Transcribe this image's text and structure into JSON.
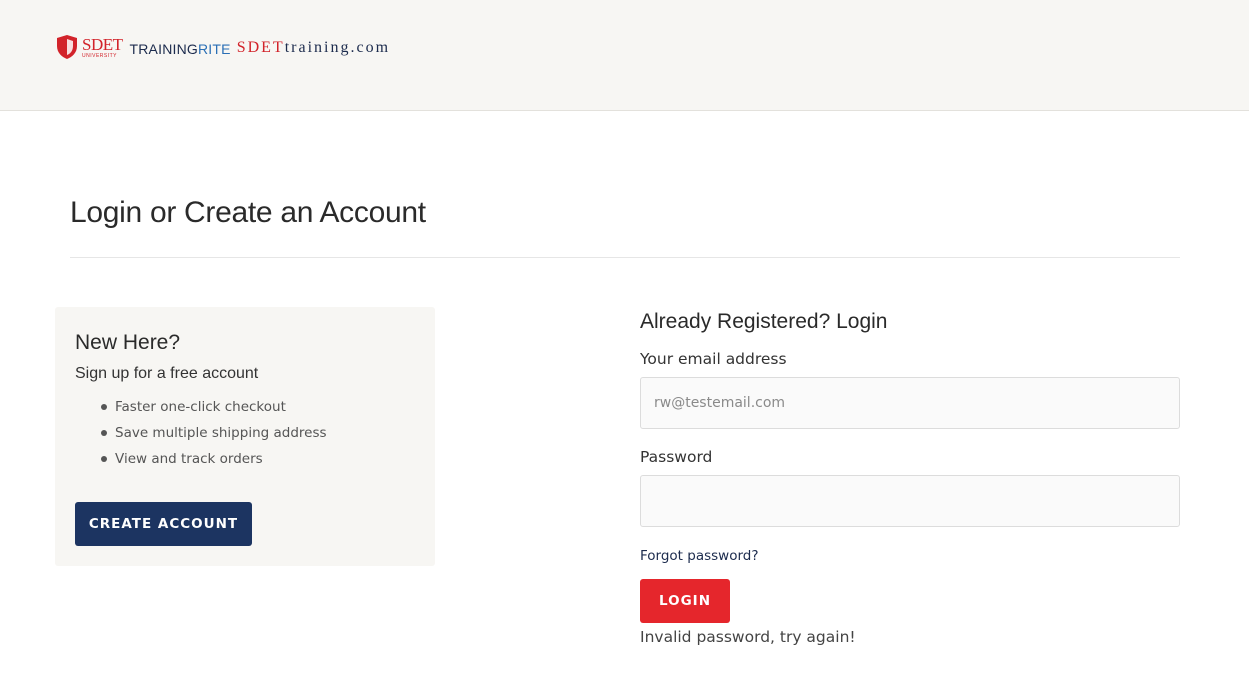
{
  "header": {
    "logo_sdet": "SDET",
    "logo_university": "UNIVERSITY",
    "logo_training": "TRAINING",
    "logo_rite": "RITE",
    "logo_sdet2": "SDET",
    "logo_training_com": "training.com"
  },
  "page": {
    "title": "Login or Create an Account"
  },
  "new_account": {
    "heading": "New Here?",
    "subheading": "Sign up for a free account",
    "benefits": [
      "Faster one-click checkout",
      "Save multiple shipping address",
      "View and track orders"
    ],
    "button_label": "CREATE ACCOUNT"
  },
  "login": {
    "heading": "Already Registered? Login",
    "email_label": "Your email address",
    "email_placeholder": "rw@testemail.com",
    "password_label": "Password",
    "password_value": "",
    "forgot_label": "Forgot password?",
    "button_label": "LOGIN",
    "error_message": "Invalid password, try again!"
  },
  "colors": {
    "brand_red": "#e5262c",
    "brand_navy": "#1c3461",
    "header_bg": "#f7f6f3"
  }
}
